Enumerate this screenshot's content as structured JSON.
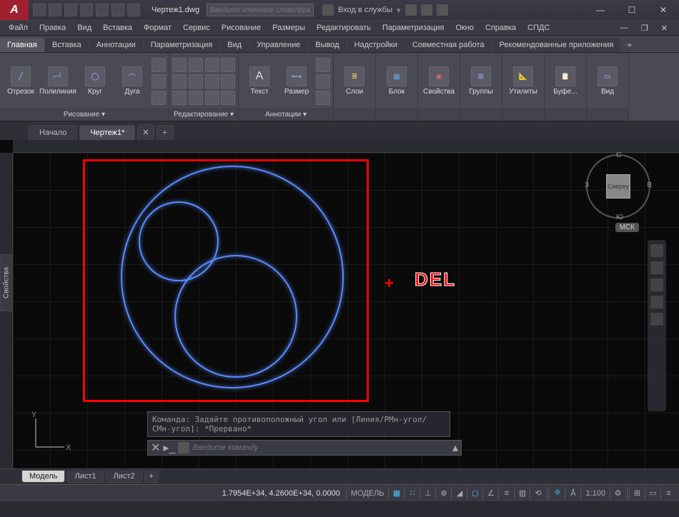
{
  "title": "Чертеж1.dwg",
  "search_placeholder": "Введите ключевое слово/фразу",
  "sign_in": "Вход в службы",
  "menu": [
    "Файл",
    "Правка",
    "Вид",
    "Вставка",
    "Формат",
    "Сервис",
    "Рисование",
    "Размеры",
    "Редактировать",
    "Параметризация",
    "Окно",
    "Справка",
    "СПДС"
  ],
  "tabs": [
    "Главная",
    "Вставка",
    "Аннотации",
    "Параметризация",
    "Вид",
    "Управление",
    "Вывод",
    "Надстройки",
    "Совместная работа",
    "Рекомендованные приложения"
  ],
  "ribbon": {
    "draw": {
      "title": "Рисование ▾",
      "line": "Отрезок",
      "pline": "Полилиния",
      "circle": "Круг",
      "arc": "Дуга"
    },
    "modify": {
      "title": "Редактирование ▾"
    },
    "annot": {
      "title": "Аннотации ▾",
      "text": "Текст",
      "dim": "Размер"
    },
    "layers": {
      "title": "Слои"
    },
    "block": {
      "title": "Блок"
    },
    "props": {
      "title": "Свойства"
    },
    "groups": {
      "title": "Группы"
    },
    "utils": {
      "title": "Утилиты"
    },
    "clip": {
      "title": "Буфе..."
    },
    "view": {
      "title": "Вид"
    }
  },
  "drawing_tabs": {
    "start": "Начало",
    "active": "Чертеж1*"
  },
  "viewcube": {
    "top": "С",
    "right": "В",
    "bottom": "Ю",
    "left": "З",
    "face": "Сверху",
    "wcs": "МСК"
  },
  "props_panel": "Свойства",
  "cmd_history": "Команда: Задайте противоположный угол или [Линия/РМн-угол/СМн-угол]: *Прервано*",
  "cmd_placeholder": "Введите команду",
  "layout_tabs": [
    "Модель",
    "Лист1",
    "Лист2"
  ],
  "status": {
    "coords": "1.7954E+34, 4.2600E+34, 0.0000",
    "model": "МОДЕЛЬ",
    "scale": "1:100"
  },
  "overlay": {
    "plus": "+",
    "del": "DEL"
  },
  "ucs": {
    "x": "X",
    "y": "Y"
  }
}
